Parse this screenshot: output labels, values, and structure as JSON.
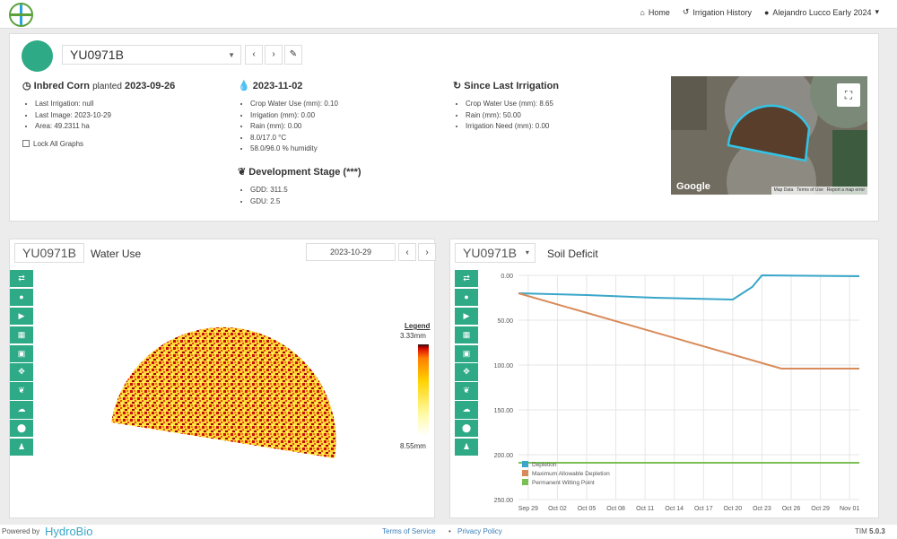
{
  "nav": {
    "home": "Home",
    "irrigation_history": "Irrigation History",
    "user": "Alejandro Lucco Early 2024"
  },
  "field": {
    "id": "YU0971B"
  },
  "crop": {
    "name": "Inbred Corn",
    "planted_label": "planted",
    "planted_date": "2023-09-26",
    "items": [
      "Last Irrigation: null",
      "Last Image: 2023-10-29",
      "Area: 49.2311 ha"
    ],
    "lock_label": "Lock All Graphs"
  },
  "weather": {
    "date": "2023-11-02",
    "items": [
      "Crop Water Use (mm): 0.10",
      "Irrigation (mm): 0.00",
      "Rain (mm): 0.00",
      "8.0/17.0 °C",
      "58.0/96.0 % humidity"
    ]
  },
  "dev": {
    "title": "Development Stage (***)",
    "items": [
      "GDD: 311.5",
      "GDU: 2.5"
    ]
  },
  "since": {
    "title": "Since Last Irrigation",
    "items": [
      "Crop Water Use (mm): 8.65",
      "Rain (mm): 50.00",
      "Irrigation Need (mm): 0.00"
    ]
  },
  "map": {
    "google": "Google",
    "footer": [
      "Map Data",
      "Terms of Use",
      "Report a map error"
    ]
  },
  "water_use": {
    "field_id": "YU0971B",
    "title": "Water Use",
    "date": "2023-10-29",
    "legend": {
      "title": "Legend",
      "max": "3.33mm",
      "min": "8.55mm"
    }
  },
  "soil": {
    "field_id": "YU0971B",
    "title": "Soil Deficit"
  },
  "chart_data": {
    "type": "line",
    "title": "Soil Deficit",
    "x_ticks": [
      "Sep 29",
      "Oct 02",
      "Oct 05",
      "Oct 08",
      "Oct 11",
      "Oct 14",
      "Oct 17",
      "Oct 20",
      "Oct 23",
      "Oct 26",
      "Oct 29",
      "Nov 01"
    ],
    "y_ticks": [
      "0.00",
      "50.00",
      "100.00",
      "150.00",
      "200.00",
      "250.00"
    ],
    "ylim": [
      0,
      250
    ],
    "y_inverted": true,
    "x_range": [
      "2023-09-28",
      "2023-11-02"
    ],
    "series": [
      {
        "name": "Depletion",
        "color": "#3aa6c9",
        "points": [
          [
            "2023-09-28",
            20
          ],
          [
            "2023-10-05",
            22
          ],
          [
            "2023-10-12",
            25
          ],
          [
            "2023-10-20",
            27
          ],
          [
            "2023-10-21",
            20
          ],
          [
            "2023-10-22",
            13
          ],
          [
            "2023-10-23",
            0
          ],
          [
            "2023-11-02",
            1
          ]
        ]
      },
      {
        "name": "Maximum Allowable Depletion",
        "color": "#d88b5a",
        "points": [
          [
            "2023-09-28",
            20
          ],
          [
            "2023-10-25",
            104
          ],
          [
            "2023-11-02",
            104
          ]
        ]
      },
      {
        "name": "Permanent Wilting Point",
        "color": "#7bbf55",
        "points": [
          [
            "2023-09-28",
            209
          ],
          [
            "2023-11-02",
            209
          ]
        ]
      }
    ]
  },
  "footer": {
    "powered": "Powered by",
    "brand": "HydroBio",
    "terms": "Terms of Service",
    "dot": "•",
    "privacy": "Privacy Policy",
    "version_label": "TIM",
    "version": "5.0.3"
  }
}
